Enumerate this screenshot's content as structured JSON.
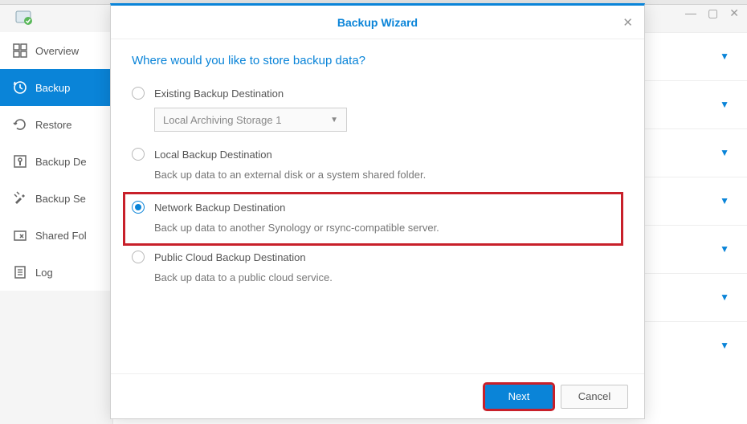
{
  "window": {
    "minimize": "—",
    "maximize": "▢",
    "close": "✕"
  },
  "sidebar": {
    "items": [
      {
        "label": "Overview"
      },
      {
        "label": "Backup"
      },
      {
        "label": "Restore"
      },
      {
        "label": "Backup De"
      },
      {
        "label": "Backup Se"
      },
      {
        "label": "Shared Fol"
      },
      {
        "label": "Log"
      }
    ]
  },
  "modal": {
    "title": "Backup Wizard",
    "question": "Where would you like to store backup data?",
    "options": {
      "existing": {
        "label": "Existing Backup Destination",
        "dropdown_value": "Local Archiving Storage 1"
      },
      "local": {
        "label": "Local Backup Destination",
        "desc": "Back up data to an external disk or a system shared folder."
      },
      "network": {
        "label": "Network Backup Destination",
        "desc": "Back up data to another Synology or rsync-compatible server."
      },
      "cloud": {
        "label": "Public Cloud Backup Destination",
        "desc": "Back up data to a public cloud service."
      }
    },
    "buttons": {
      "next": "Next",
      "cancel": "Cancel"
    }
  }
}
